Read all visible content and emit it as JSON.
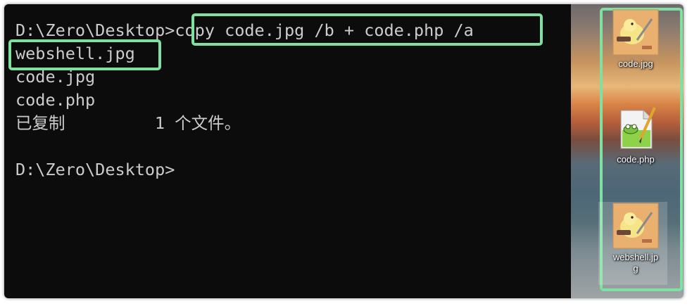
{
  "terminal": {
    "prompt_line": "D:\\Zero\\Desktop>",
    "command": "copy code.jpg /b + code.php /a",
    "output_target": "webshell.jpg",
    "output_files": [
      "code.jpg",
      "code.php"
    ],
    "copied_status": "已复制         1 个文件。",
    "final_prompt": "D:\\Zero\\Desktop>"
  },
  "desktop": {
    "icons": [
      {
        "label": "code.jpg",
        "icon": "image-file-icon"
      },
      {
        "label": "code.php",
        "icon": "notepad-plus-plus-file-icon"
      },
      {
        "label_line1": "webshell.jp",
        "label_line2": "g",
        "icon": "image-file-icon"
      }
    ]
  },
  "colors": {
    "terminal_bg": "#0c0c0c",
    "terminal_text": "#cccccc",
    "highlight_border": "#7fe0a2"
  }
}
